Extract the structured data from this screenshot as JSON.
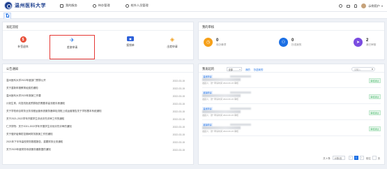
{
  "header": {
    "logo_text": "温州医科大学",
    "nav": [
      {
        "label": "我的服务",
        "icon": "monitor-icon"
      },
      {
        "label": "待办管理",
        "icon": "todo-icon"
      },
      {
        "label": "校外人员管理",
        "icon": "people-icon"
      }
    ],
    "user_name": "示例用户"
  },
  "flow": {
    "title": "发起流程",
    "items": [
      {
        "label": "补签退休",
        "icon": "dollar-icon",
        "color": "#e8503a"
      },
      {
        "label": "差旅申请",
        "icon": "plane-icon",
        "color": "#1b6fe4"
      },
      {
        "label": "报销单",
        "icon": "monitor-icon",
        "color": "#2b5fd9"
      },
      {
        "label": "出差申请",
        "icon": "stack-icon",
        "color": "#f0a020"
      }
    ]
  },
  "tasks": {
    "title": "我的审核",
    "items": [
      {
        "count": "0",
        "label": "待办事项",
        "color": "#f6a019",
        "icon": "clock-icon"
      },
      {
        "count": "0",
        "label": "抄送我的",
        "color": "#1b6fe4",
        "icon": "people-icon"
      },
      {
        "count": "2",
        "label": "我已审核",
        "color": "#7a4ce0",
        "icon": "send-icon"
      }
    ]
  },
  "notice": {
    "title": "公告通知",
    "rows": [
      {
        "text": "温州医科大学2022年度部门预算公开",
        "date": "2022-03-15"
      },
      {
        "text": "关于重新申报教育经费的通知",
        "date": "2022-03-15"
      },
      {
        "text": "温州医科大学2020年报销工作要",
        "date": "2022-03-15"
      },
      {
        "text": "计划生育，向发改批准预算批的需要求高流程手册通知",
        "date": "2022-03-15"
      },
      {
        "text": "关于学校综合财务业务流程运营系统服务器体检流程上线运营报告关于学校基本系统通知",
        "date": "2022-03-15"
      },
      {
        "text": "关于2021-2022学年开展学生评优评先评审工作的通知",
        "date": "2022-03-15"
      },
      {
        "text": "仁济学院：关于2021-2022学年开展学生评优评先评审的通知",
        "date": "2022-03-15"
      },
      {
        "text": "关于做好疫情防控期间财务报销工作的通知",
        "date": "2022-03-15"
      },
      {
        "text": "2021年下半年高校财务数据报告，重要财务业务通知",
        "date": "2022-03-15"
      },
      {
        "text": "关于2020年度财务系统服务器数据的通知",
        "date": "2022-03-15"
      }
    ]
  },
  "apply": {
    "title": "我发起的",
    "filter": "全部",
    "tabs": [
      "我的",
      "抄送我的"
    ],
    "search_placeholder": "请输入",
    "cards": [
      {
        "tag": "差旅申请",
        "meta": "发起人：张* 申请时间 2022-06-15 审核",
        "status": "审核通过"
      },
      {
        "tag": "报销申请",
        "meta": "发起人：张* 申请时间 2022-06-15 审核",
        "status": "审核通过"
      },
      {
        "tag": "差旅申请",
        "meta": "发起人：张* 申请时间 2022-06-15 审核",
        "status": "审核通过"
      },
      {
        "tag": "报销申请",
        "meta": "发起人：张* 申请时间 2022-06-15 审核",
        "status": "审核通过"
      }
    ],
    "pager": {
      "total": "共 4 条",
      "size": "10条/页",
      "pages": [
        "1"
      ],
      "goto": "前往",
      "page_unit": "页"
    }
  }
}
